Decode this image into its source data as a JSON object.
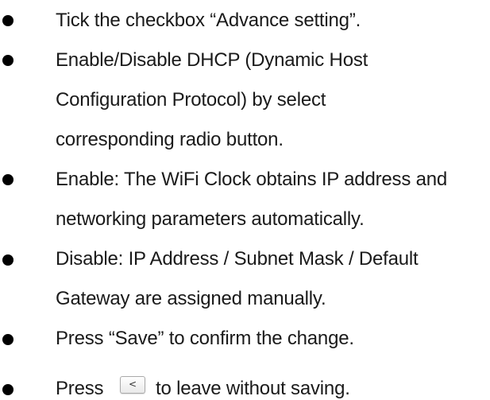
{
  "instructions": [
    {
      "lines": [
        "Tick the checkbox “Advance setting”."
      ]
    },
    {
      "lines": [
        "Enable/Disable DHCP (Dynamic Host",
        "Configuration Protocol) by select",
        "corresponding radio button."
      ]
    },
    {
      "lines": [
        "Enable: The WiFi Clock obtains IP address and",
        "networking parameters automatically."
      ]
    },
    {
      "lines": [
        "Disable: IP Address / Subnet Mask / Default",
        "Gateway are assigned manually."
      ]
    },
    {
      "lines": [
        "Press “Save” to confirm the change."
      ]
    },
    {
      "prefix": "Press",
      "button_label": "<",
      "suffix": "to leave without saving."
    }
  ]
}
